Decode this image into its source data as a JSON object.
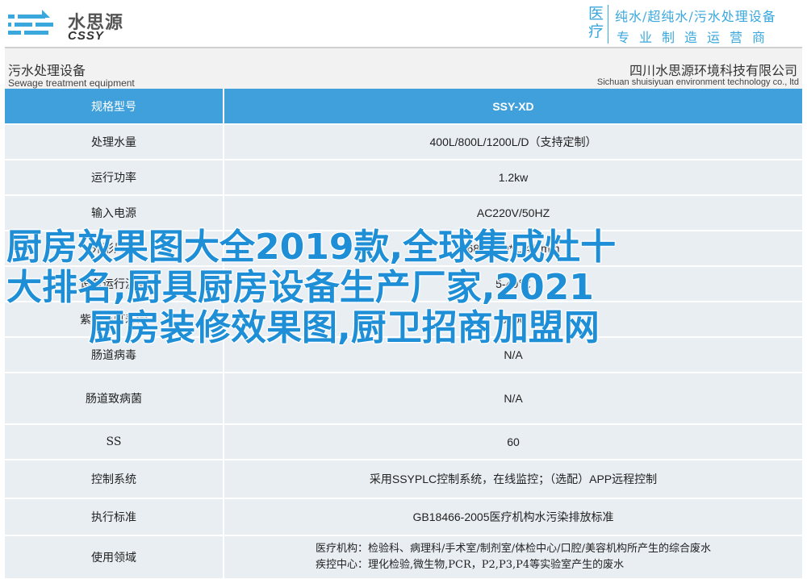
{
  "header": {
    "logo_cn": "水思源",
    "logo_en": "CSSY",
    "brand_left": [
      "医",
      "疗"
    ],
    "brand_line1": "纯水/超纯水/污水处理设备",
    "brand_line2": "专业制造运营商"
  },
  "sub_header": {
    "left_cn": "污水处理设备",
    "left_en": "Sewage treatment equipment",
    "right_cn": "四川水思源环境科技有限公司",
    "right_en": "Sichuan shuisiyuan environment technology co., ltd"
  },
  "table": {
    "head_label": "规格型号",
    "head_value": "SSY-XD",
    "rows": [
      {
        "label": "处理水量",
        "value": "400L/800L/1200L/D（支持定制）"
      },
      {
        "label": "运行功率",
        "value": "1.2kw"
      },
      {
        "label": "输入电源",
        "value": "AC220V/50HZ"
      },
      {
        "label": "外形尺寸",
        "value": "680*560*1140 mm"
      },
      {
        "label": "设备运行温度",
        "value": "5-40℃"
      },
      {
        "label": "紫外杀灯寿命",
        "value": "5000"
      },
      {
        "label": "肠道病毒",
        "value": "N/A"
      },
      {
        "label": "肠道致病菌",
        "value": "N/A"
      },
      {
        "label": "SS",
        "value": "60"
      },
      {
        "label": "控制系统",
        "value": "采用SSYPLC控制系统，在线监控；（选配）APP远程控制"
      },
      {
        "label": "执行标准",
        "value": "GB18466-2005医疗机构水污染排放标准"
      }
    ],
    "usage_label": "使用领域",
    "usage_line1": "医疗机构：检验科、病理科/手术室/制剂室/体检中心/口腔/美容机构所产生的综合废水",
    "usage_line2": "疾控中心：理化检验,微生物,PCR，P2,P3,P4等实验室产生的废水"
  },
  "overlay": {
    "line1": "厨房效果图大全2019款,全球集成灶十",
    "line2": "大排名,厨具厨房设备生产厂家,2021",
    "line3": "厨房装修效果图,厨卫招商加盟网"
  },
  "colors": {
    "accent": "#3fa0dc",
    "row_bg": "#e9eef3",
    "overlay_text": "#1e8fd6"
  }
}
